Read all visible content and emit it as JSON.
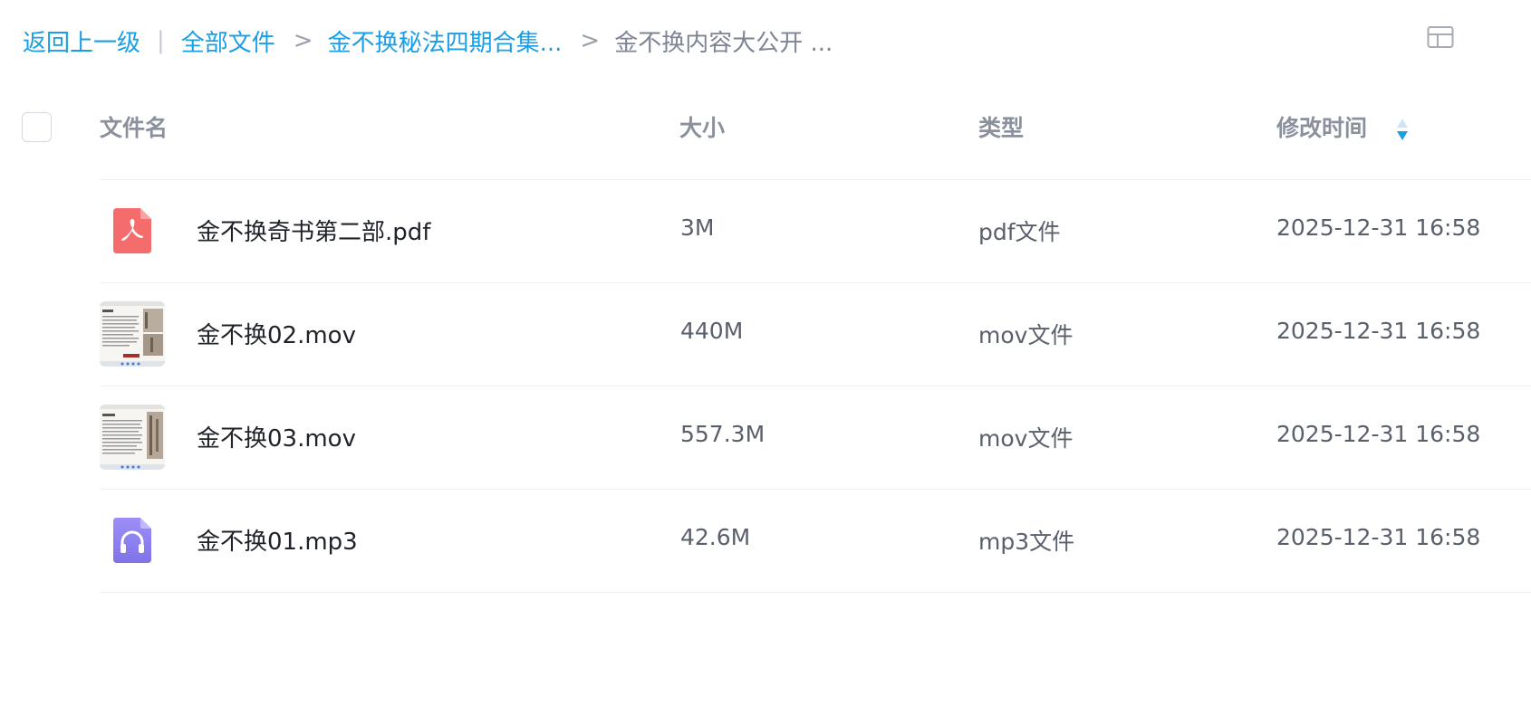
{
  "breadcrumb": {
    "back_label": "返回上一级",
    "items": [
      {
        "label": "全部文件"
      },
      {
        "label": "金不换秘法四期合集..."
      }
    ],
    "current": "金不换内容大公开 ...",
    "separator_pipe": "|",
    "separator_arrow": ">"
  },
  "toolbar": {
    "layout_toggle_icon": "grid-layout-icon"
  },
  "table": {
    "columns": {
      "name": "文件名",
      "size": "大小",
      "type": "类型",
      "mtime": "修改时间"
    },
    "sort": {
      "column": "mtime",
      "direction": "descending",
      "icon": "sort-icon"
    },
    "rows": [
      {
        "name": "金不换奇书第二部.pdf",
        "size": "3M",
        "type": "pdf文件",
        "mtime": "2025-12-31 16:58",
        "icon": "pdf-icon"
      },
      {
        "name": "金不换02.mov",
        "size": "440M",
        "type": "mov文件",
        "mtime": "2025-12-31 16:58",
        "icon": "video-thumbnail"
      },
      {
        "name": "金不换03.mov",
        "size": "557.3M",
        "type": "mov文件",
        "mtime": "2025-12-31 16:58",
        "icon": "video-thumbnail"
      },
      {
        "name": "金不换01.mp3",
        "size": "42.6M",
        "type": "mp3文件",
        "mtime": "2025-12-31 16:58",
        "icon": "audio-icon"
      }
    ]
  },
  "colors": {
    "link": "#1a9ee6",
    "pdf_icon": "#f56c6c",
    "audio_icon": "#8b7cf0",
    "sort_active": "#1a9ee6"
  }
}
